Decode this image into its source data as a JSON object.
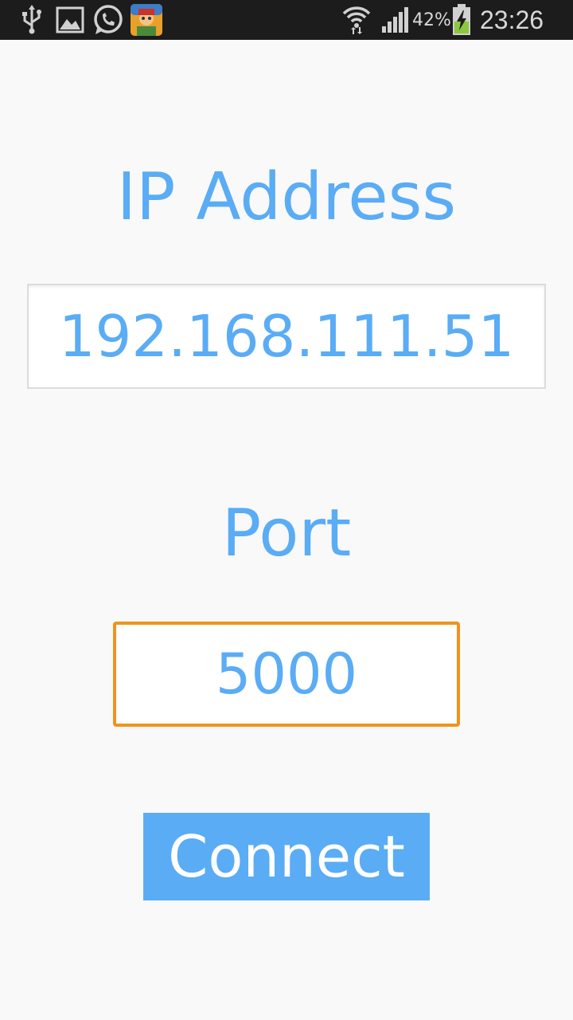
{
  "status_bar": {
    "icons": [
      "usb-icon",
      "image-icon",
      "whatsapp-icon",
      "game-app-icon",
      "wifi-icon",
      "signal-icon",
      "battery-icon"
    ],
    "battery_percent": "42%",
    "time": "23:26"
  },
  "form": {
    "ip_label": "IP Address",
    "ip_value": "192.168.111.51",
    "port_label": "Port",
    "port_value": "5000",
    "connect_label": "Connect"
  },
  "colors": {
    "accent": "#5aacf5",
    "focus_border": "#f0931e",
    "background": "#f9f9f9",
    "status_bar": "#1c1c1c"
  }
}
